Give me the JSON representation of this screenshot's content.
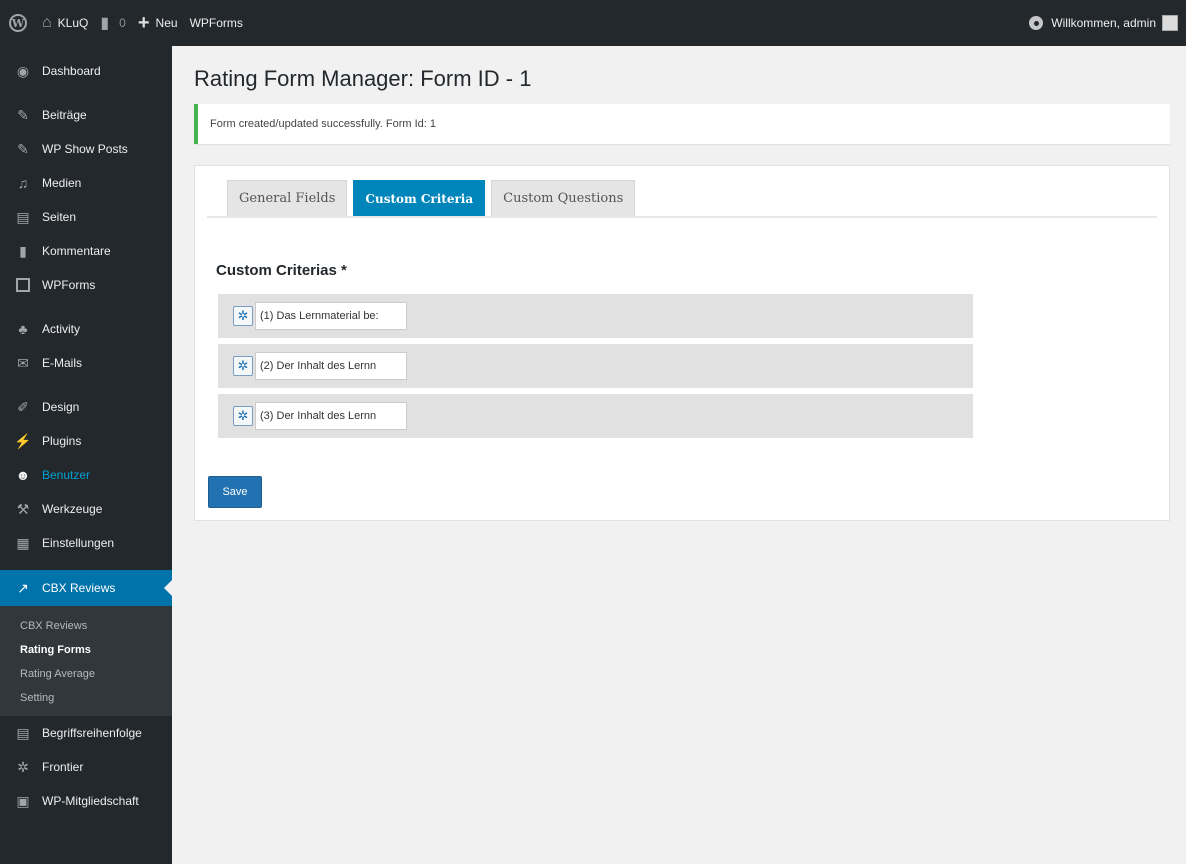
{
  "admin_bar": {
    "site_name": "KLuQ",
    "comments_count": "0",
    "new_label": "Neu",
    "wpforms_label": "WPForms",
    "welcome": "Willkommen, admin"
  },
  "sidebar": {
    "items": [
      {
        "label": "Dashboard",
        "icon": "dashboard-icon"
      },
      {
        "label": "Beiträge",
        "icon": "pin-icon"
      },
      {
        "label": "WP Show Posts",
        "icon": "pin-icon"
      },
      {
        "label": "Medien",
        "icon": "media-icon"
      },
      {
        "label": "Seiten",
        "icon": "pages-icon"
      },
      {
        "label": "Kommentare",
        "icon": "comments-icon"
      },
      {
        "label": "WPForms",
        "icon": "wpforms-icon"
      },
      {
        "label": "Activity",
        "icon": "activity-icon"
      },
      {
        "label": "E-Mails",
        "icon": "mail-icon"
      },
      {
        "label": "Design",
        "icon": "brush-icon"
      },
      {
        "label": "Plugins",
        "icon": "plugin-icon"
      },
      {
        "label": "Benutzer",
        "icon": "user-icon"
      },
      {
        "label": "Werkzeuge",
        "icon": "wrench-icon"
      },
      {
        "label": "Einstellungen",
        "icon": "settings-icon"
      },
      {
        "label": "CBX Reviews",
        "icon": "chart-icon"
      }
    ],
    "submenu": [
      "CBX Reviews",
      "Rating Forms",
      "Rating Average",
      "Setting"
    ],
    "after_items": [
      {
        "label": "Begriffsreihenfolge",
        "icon": "list-icon"
      },
      {
        "label": "Frontier",
        "icon": "gear-icon"
      },
      {
        "label": "WP-Mitgliedschaft",
        "icon": "membership-icon"
      }
    ]
  },
  "main": {
    "title": "Rating Form Manager: Form ID - 1",
    "notice": "Form created/updated successfully. Form Id: 1",
    "tabs": [
      "General Fields",
      "Custom Criteria",
      "Custom Questions"
    ],
    "active_tab": "Custom Criteria",
    "section_title": "Custom Criterias *",
    "criteria": [
      "(1) Das Lernmaterial be:",
      "(2) Der Inhalt des Lernn",
      "(3) Der Inhalt des Lernn"
    ],
    "save_label": "Save"
  },
  "colors": {
    "admin_dark": "#23282d",
    "accent_blue": "#0073aa",
    "tab_active": "#0085ba",
    "notice_green": "#46b450",
    "save_blue": "#2271b1"
  }
}
